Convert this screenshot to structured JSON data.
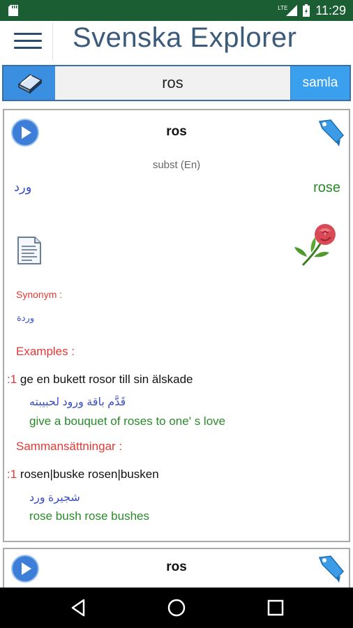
{
  "status_bar": {
    "network": "LTE",
    "time": "11:29"
  },
  "app_bar": {
    "title": "Svenska Explorer"
  },
  "search": {
    "value": "ros",
    "button_label": "samla"
  },
  "entry": {
    "word": "ros",
    "part_of_speech": "subst (En)",
    "arabic": "ورد",
    "english": "rose",
    "synonym_label": "Synonym :",
    "synonym_value": "وردة",
    "examples_label": "Examples :",
    "examples": [
      {
        "num": ":1",
        "sv": "ge en bukett rosor till sin älskade",
        "ar": "قَدَّم باقة ورود لحبيبته",
        "en": "give a bouquet of roses to one' s love"
      }
    ],
    "compounds_label": "Sammansättningar :",
    "compounds": [
      {
        "num": ":1",
        "sv": "rosen|buske rosen|busken",
        "ar": "شجيرة ورد",
        "en": "rose bush rose bushes"
      }
    ]
  },
  "next_entry": {
    "word": "ros"
  },
  "colors": {
    "status_bar": "#1b5e33",
    "accent_blue": "#3aa0ee",
    "title": "#3c5a7a",
    "section_red": "#e53935",
    "english_green": "#2a8a2a",
    "arabic_blue": "#3a4fbf"
  },
  "icons": [
    "sd-card-icon",
    "signal-icon",
    "battery-icon",
    "menu-icon",
    "eraser-icon",
    "play-icon",
    "bookmark-icon",
    "document-icon",
    "rose-image",
    "back-icon",
    "home-icon",
    "recents-icon"
  ]
}
